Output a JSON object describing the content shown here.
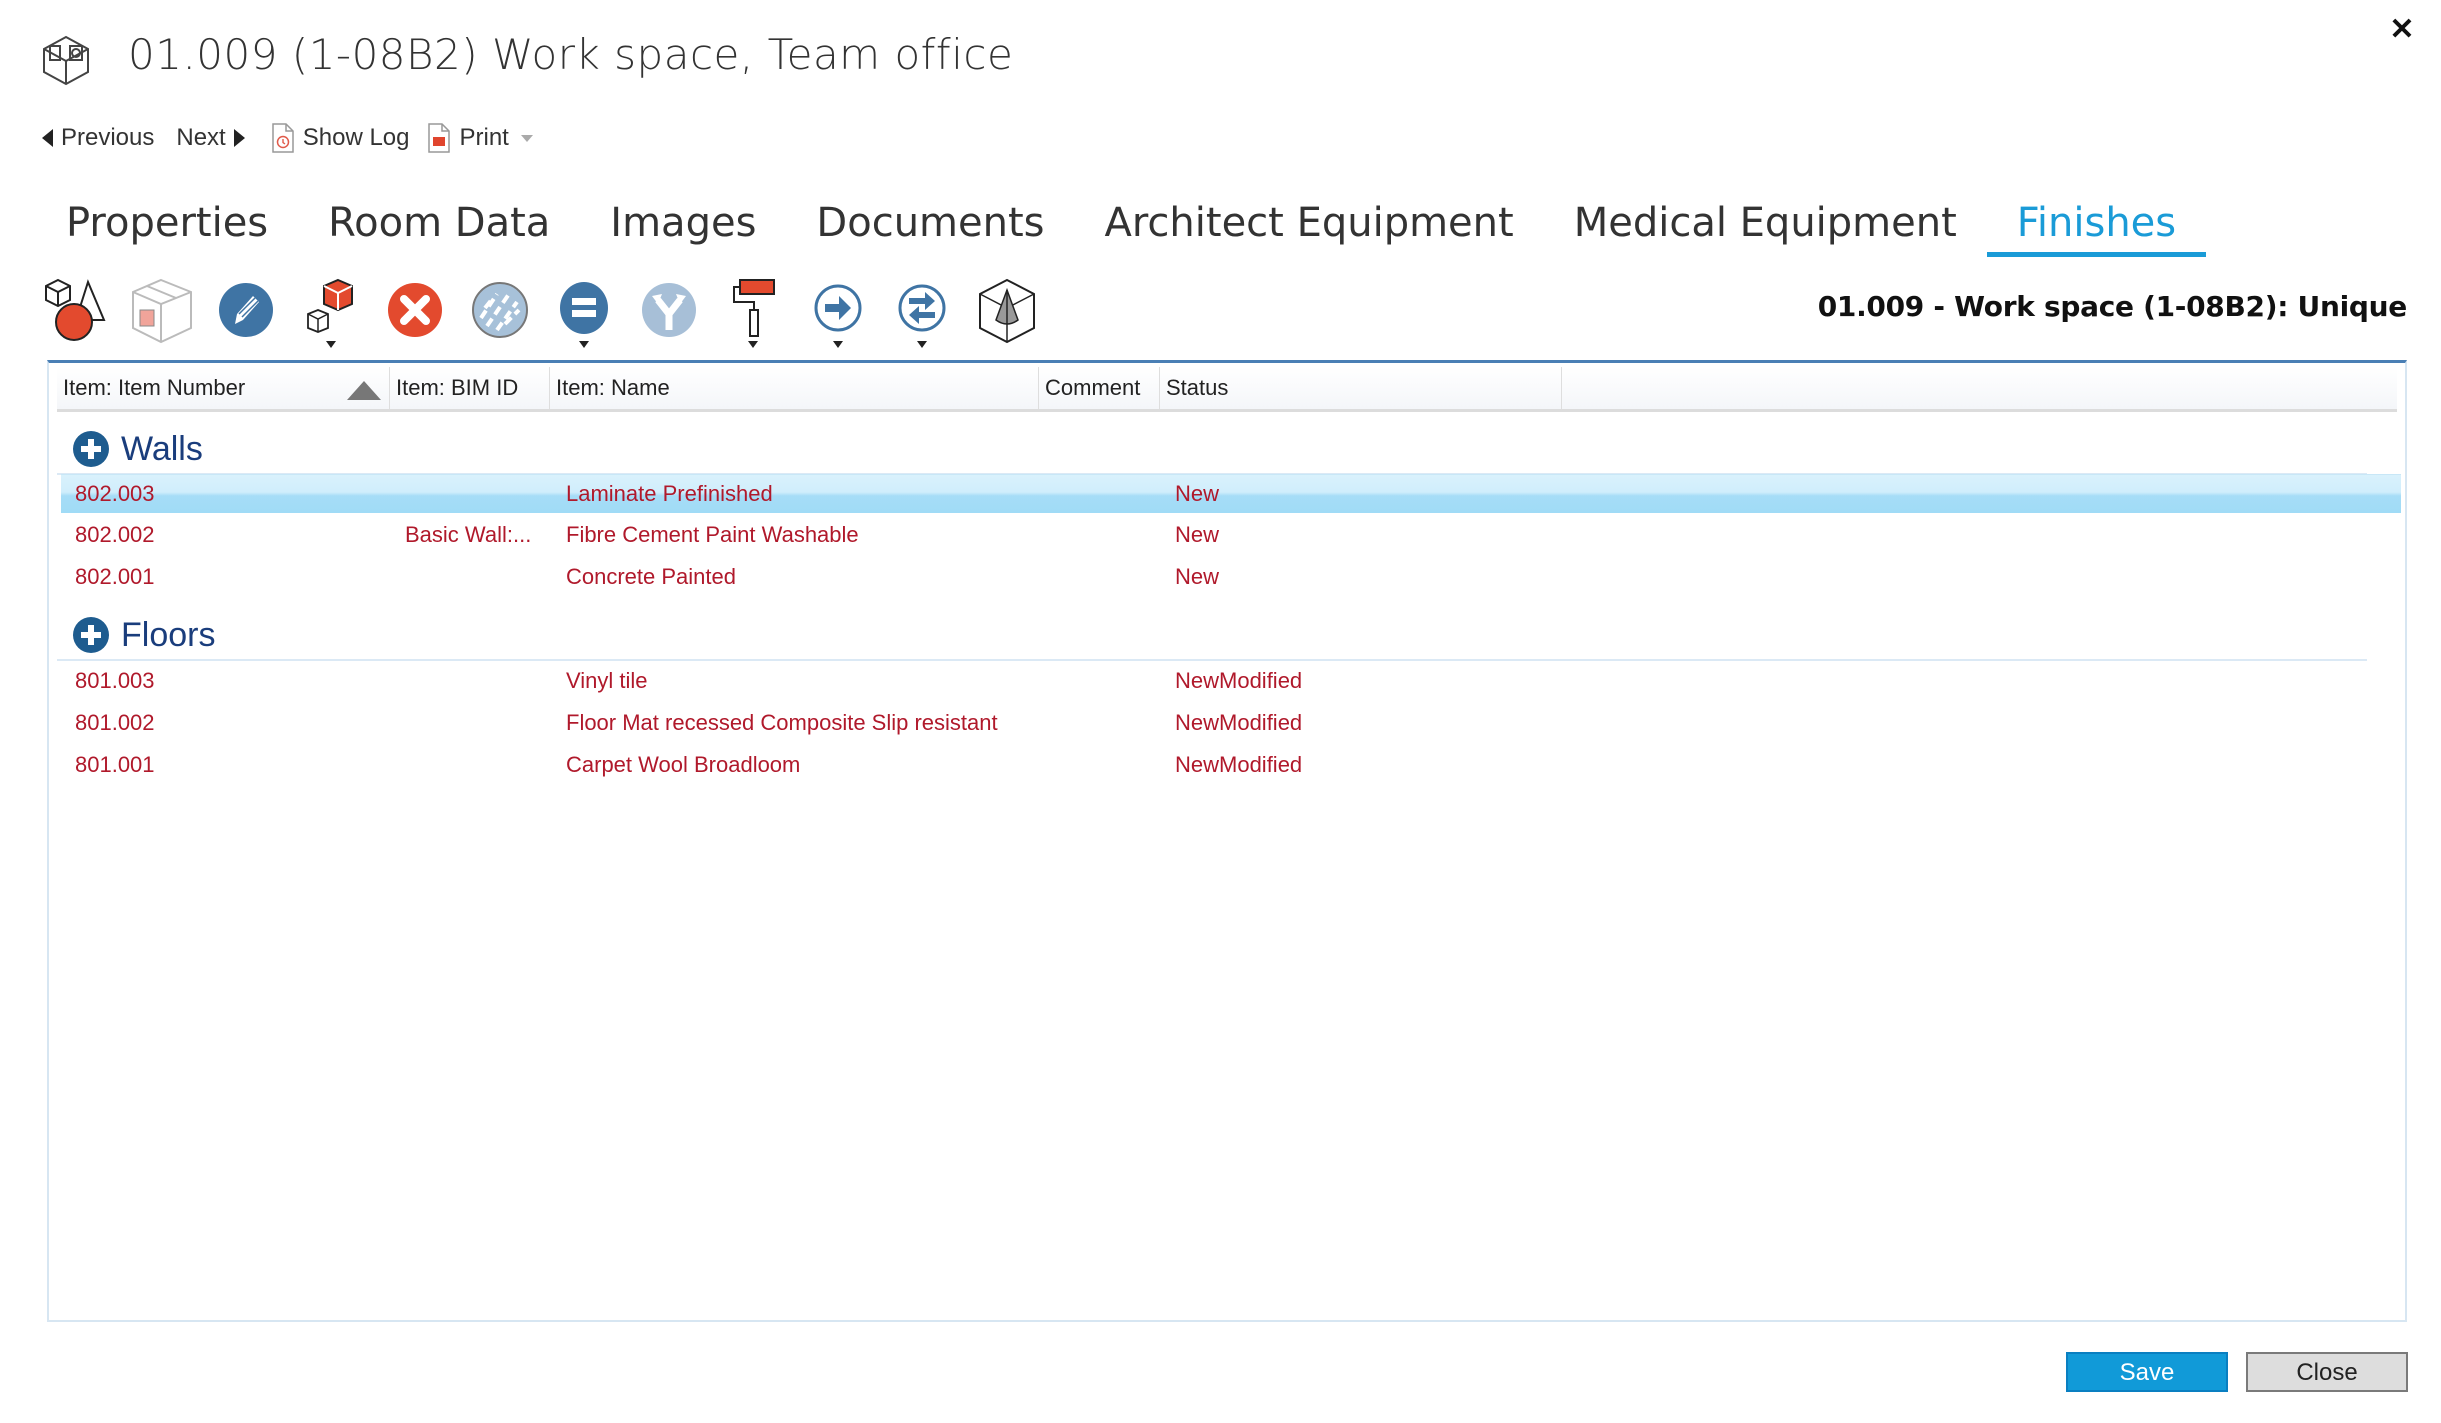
{
  "window": {
    "title": "01.009 (1-08B2) Work space, Team office",
    "close_icon": "close-x-icon"
  },
  "nav": {
    "previous": "Previous",
    "next": "Next",
    "show_log": "Show Log",
    "print": "Print"
  },
  "tabs": [
    {
      "label": "Properties",
      "active": false
    },
    {
      "label": "Room Data",
      "active": false
    },
    {
      "label": "Images",
      "active": false
    },
    {
      "label": "Documents",
      "active": false
    },
    {
      "label": "Architect Equipment",
      "active": false
    },
    {
      "label": "Medical Equipment",
      "active": false
    },
    {
      "label": "Finishes",
      "active": true
    }
  ],
  "toolbar": {
    "icons": [
      {
        "name": "shapes-icon",
        "dropdown": false
      },
      {
        "name": "room-box-icon",
        "dropdown": false
      },
      {
        "name": "edit-pencil-icon",
        "dropdown": false
      },
      {
        "name": "cubes-icon",
        "dropdown": true
      },
      {
        "name": "delete-icon",
        "dropdown": false
      },
      {
        "name": "hatch-pattern-icon",
        "dropdown": false
      },
      {
        "name": "equals-icon",
        "dropdown": true
      },
      {
        "name": "merge-icon",
        "dropdown": false
      },
      {
        "name": "paint-roller-icon",
        "dropdown": true
      },
      {
        "name": "arrow-right-icon",
        "dropdown": true
      },
      {
        "name": "swap-arrows-icon",
        "dropdown": true
      },
      {
        "name": "cone-in-box-icon",
        "dropdown": false
      }
    ],
    "context_label": "01.009 - Work space (1-08B2): Unique"
  },
  "grid": {
    "columns": [
      "Item: Item Number",
      "Item: BIM ID",
      "Item: Name",
      "Comment",
      "Status"
    ],
    "sort": {
      "column": "Item: Item Number",
      "direction": "ascending"
    },
    "groups": [
      {
        "label": "Walls",
        "rows": [
          {
            "number": "802.003",
            "bim_id": "",
            "name": "Laminate Prefinished",
            "comment": "",
            "status": "New",
            "selected": true
          },
          {
            "number": "802.002",
            "bim_id": "Basic Wall:...",
            "name": "Fibre Cement Paint Washable",
            "comment": "",
            "status": "New",
            "selected": false
          },
          {
            "number": "802.001",
            "bim_id": "",
            "name": "Concrete Painted",
            "comment": "",
            "status": "New",
            "selected": false
          }
        ]
      },
      {
        "label": "Floors",
        "rows": [
          {
            "number": "801.003",
            "bim_id": "",
            "name": "Vinyl tile",
            "comment": "",
            "status": "NewModified",
            "selected": false
          },
          {
            "number": "801.002",
            "bim_id": "",
            "name": "Floor Mat recessed Composite Slip resistant",
            "comment": "",
            "status": "NewModified",
            "selected": false
          },
          {
            "number": "801.001",
            "bim_id": "",
            "name": "Carpet Wool Broadloom",
            "comment": "",
            "status": "NewModified",
            "selected": false
          }
        ]
      }
    ]
  },
  "footer": {
    "save": "Save",
    "close": "Close"
  },
  "colors": {
    "accent": "#1a9bd7",
    "row_text": "#b0192b",
    "group_text": "#1a3d7c",
    "save_button": "#119ad8"
  }
}
